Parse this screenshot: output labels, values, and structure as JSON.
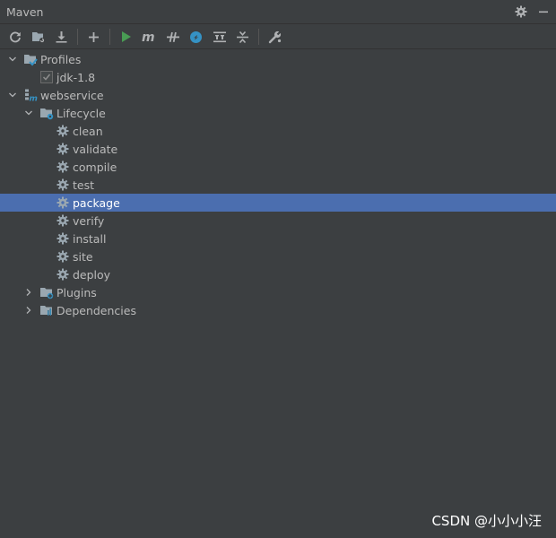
{
  "window": {
    "title": "Maven",
    "settings_icon": "gear-icon",
    "hide_icon": "minimize-icon"
  },
  "toolbar": {
    "tools": [
      "reload-icon",
      "generate-sources-icon",
      "download-icon",
      "add-icon",
      "run-icon",
      "execute-goal-icon",
      "toggle-offline-icon",
      "skip-tests-icon",
      "show-dependencies-icon",
      "collapse-all-icon",
      "settings-wrench-icon"
    ]
  },
  "tree": {
    "profiles_label": "Profiles",
    "profile_item": "jdk-1.8",
    "project_label": "webservice",
    "lifecycle_label": "Lifecycle",
    "goals": [
      "clean",
      "validate",
      "compile",
      "test",
      "package",
      "verify",
      "install",
      "site",
      "deploy"
    ],
    "selected_goal": "package",
    "plugins_label": "Plugins",
    "dependencies_label": "Dependencies"
  },
  "watermark": "CSDN @小小小汪",
  "colors": {
    "background": "#3c3f41",
    "selection": "#4b6eaf",
    "run_green": "#499c54",
    "skip_blue": "#3592c4"
  }
}
